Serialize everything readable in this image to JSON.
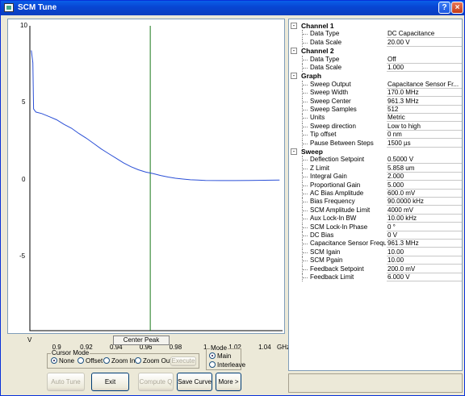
{
  "window": {
    "title": "SCM Tune",
    "help": "?",
    "close": "×"
  },
  "plot": {
    "y_ticks": [
      "10",
      "5",
      "0",
      "-5"
    ],
    "y_unit": "V",
    "x_ticks": [
      "0.9",
      "0.92",
      "0.94",
      "0.96",
      "0.98",
      "1",
      "1.02",
      "1.04"
    ],
    "x_unit": "GHz",
    "center_peak_label": "Center Peak"
  },
  "chart_data": {
    "type": "line",
    "xlim": [
      0.882,
      1.052
    ],
    "ylim": [
      -9.8,
      10
    ],
    "x_unit": "GHz",
    "y_unit": "V",
    "cursor_x": 0.963,
    "series": [
      {
        "x": [
          0.883,
          0.884,
          0.8845,
          0.886,
          0.89,
          0.895,
          0.9,
          0.905,
          0.91,
          0.915,
          0.92,
          0.925,
          0.93,
          0.935,
          0.94,
          0.945,
          0.95,
          0.955,
          0.96,
          0.965,
          0.97,
          0.975,
          0.98,
          0.985,
          0.99,
          0.995,
          1.0,
          1.01,
          1.02,
          1.03,
          1.04,
          1.05
        ],
        "y": [
          8.4,
          7.6,
          4.6,
          4.4,
          4.3,
          4.1,
          3.9,
          3.6,
          3.35,
          3.0,
          2.7,
          2.35,
          2.0,
          1.7,
          1.4,
          1.1,
          0.85,
          0.65,
          0.5,
          0.4,
          0.28,
          0.18,
          0.1,
          0.05,
          0.0,
          -0.02,
          -0.04,
          -0.05,
          -0.05,
          -0.04,
          -0.03,
          -0.02
        ]
      }
    ]
  },
  "cursor_mode": {
    "title": "Cursor Mode",
    "options": [
      "None",
      "Offset",
      "Zoom In",
      "Zoom Out"
    ],
    "selected": "None",
    "execute": "Execute"
  },
  "mode": {
    "title": "Mode",
    "options": [
      "Main",
      "Interleave"
    ],
    "selected": "Main"
  },
  "buttons": {
    "auto_tune": "Auto Tune",
    "exit": "Exit",
    "compute_q": "Compute Q",
    "save_curve": "Save Curve",
    "more": "More >"
  },
  "properties": {
    "sections": [
      {
        "name": "Channel 1",
        "toggle": "-",
        "items": [
          {
            "label": "Data Type",
            "value": "DC Capacitance"
          },
          {
            "label": "Data Scale",
            "value": "20.00 V"
          }
        ]
      },
      {
        "name": "Channel 2",
        "toggle": "-",
        "items": [
          {
            "label": "Data Type",
            "value": "Off"
          },
          {
            "label": "Data Scale",
            "value": "1.000"
          }
        ]
      },
      {
        "name": "Graph",
        "toggle": "-",
        "items": [
          {
            "label": "Sweep Output",
            "value": "Capacitance Sensor Fr..."
          },
          {
            "label": "Sweep Width",
            "value": "170.0 MHz"
          },
          {
            "label": "Sweep Center",
            "value": "961.3 MHz"
          },
          {
            "label": "Sweep Samples",
            "value": "512"
          },
          {
            "label": "Units",
            "value": "Metric"
          },
          {
            "label": "Sweep direction",
            "value": "Low to high"
          },
          {
            "label": "Tip offset",
            "value": "0 nm"
          },
          {
            "label": "Pause Between Steps",
            "value": "1500 µs"
          }
        ]
      },
      {
        "name": "Sweep",
        "toggle": "-",
        "items": [
          {
            "label": "Deflection Setpoint",
            "value": "0.5000 V"
          },
          {
            "label": "Z Limit",
            "value": "5.858 um"
          },
          {
            "label": "Integral Gain",
            "value": "2.000"
          },
          {
            "label": "Proportional Gain",
            "value": "5.000"
          },
          {
            "label": "AC Bias Amplitude",
            "value": "600.0 mV"
          },
          {
            "label": "Bias Frequency",
            "value": "90.0000 kHz"
          },
          {
            "label": "SCM Amplitude Limit",
            "value": "4000 mV"
          },
          {
            "label": "Aux Lock-In BW",
            "value": "10.00 kHz"
          },
          {
            "label": "SCM Lock-In Phase",
            "value": "0 °"
          },
          {
            "label": "DC Bias",
            "value": "0 V"
          },
          {
            "label": "Capacitance Sensor Freque",
            "value": "961.3 MHz"
          },
          {
            "label": "SCM Igain",
            "value": "10.00"
          },
          {
            "label": "SCM Pgain",
            "value": "10.00"
          },
          {
            "label": "Feedback Setpoint",
            "value": "200.0 mV"
          },
          {
            "label": "Feedback Limit",
            "value": "6.000 V"
          }
        ]
      }
    ]
  },
  "colors": {
    "curve": "#2a4fd6",
    "cursor": "#1a7a1a",
    "titlebar": "#0846d4"
  }
}
